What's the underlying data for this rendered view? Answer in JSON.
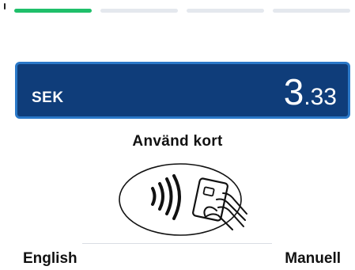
{
  "progress": {
    "steps_total": 4,
    "steps_completed": 1,
    "active_color": "#1fbf6a"
  },
  "payment": {
    "currency": "SEK",
    "amount_integer": "3",
    "amount_decimal": ".33",
    "box_color": "#0f3d7a",
    "border_color": "#2a78c8"
  },
  "instruction": {
    "text": "Använd kort"
  },
  "graphic": {
    "icon": "contactless-card-tap-icon"
  },
  "soft_buttons": {
    "left_label": "English",
    "right_label": "Manuell"
  }
}
